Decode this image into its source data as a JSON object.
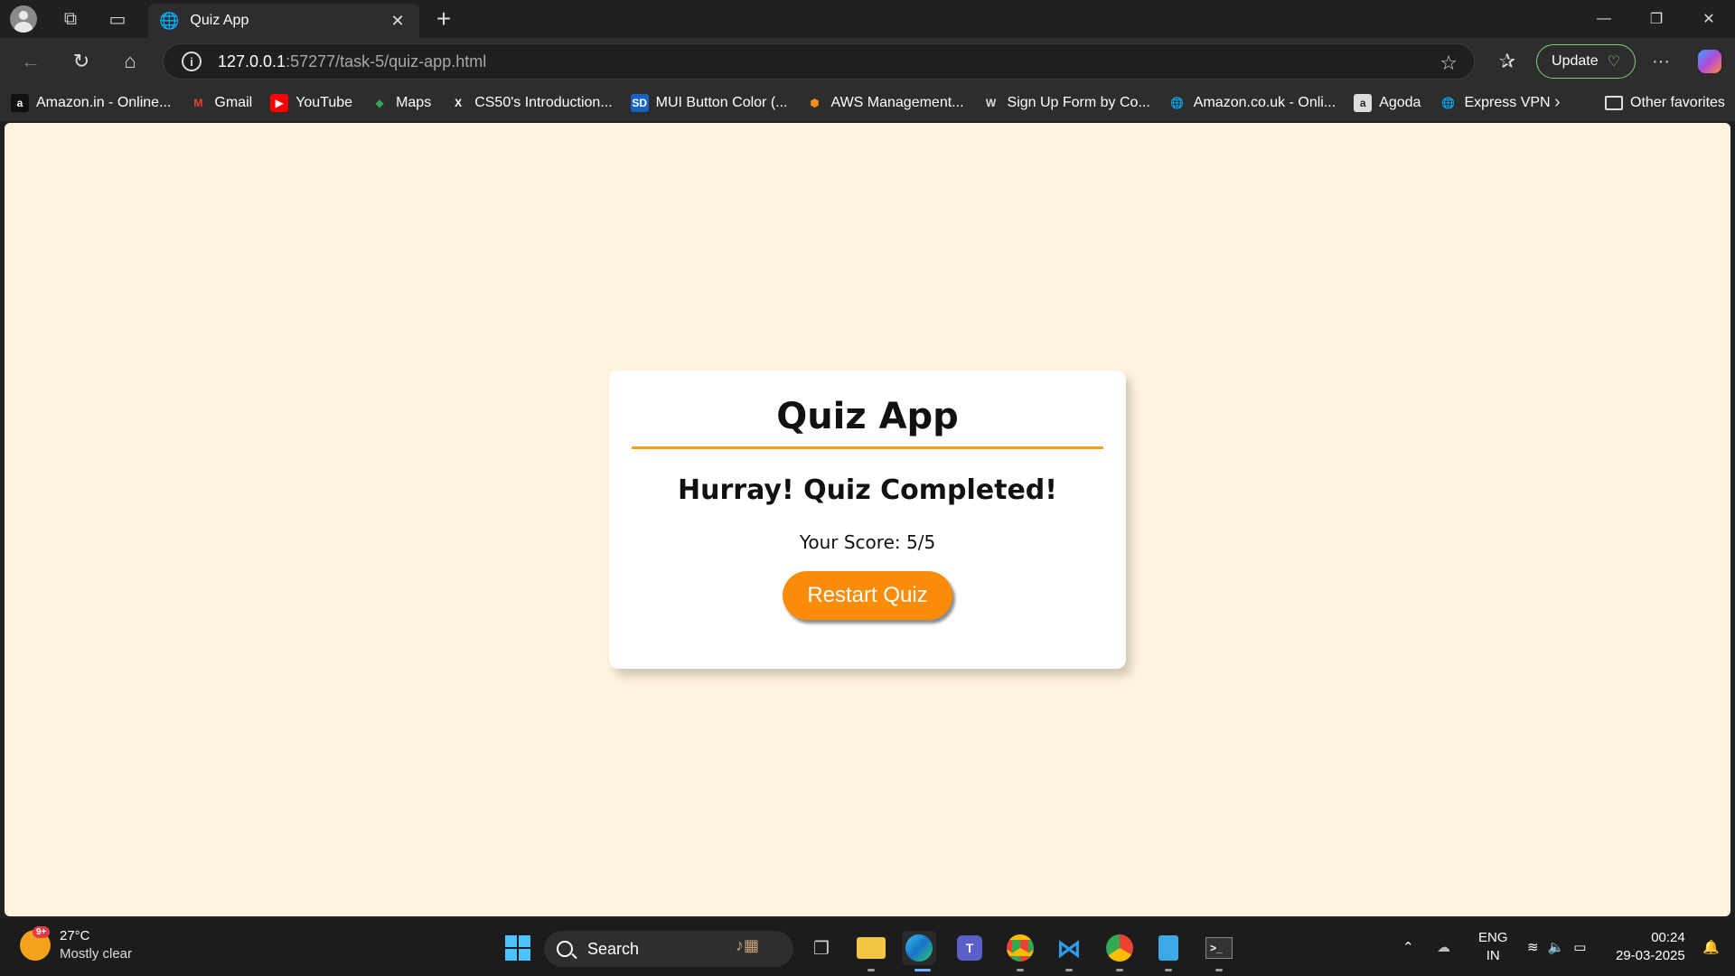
{
  "browser": {
    "tab_title": "Quiz App",
    "url_host": "127.0.0.1",
    "url_rest": ":57277/task-5/quiz-app.html",
    "update_label": "Update"
  },
  "favorites": [
    {
      "label": "Amazon.in - Online...",
      "icon": "a",
      "color": "#ffffff",
      "bg": "#111111"
    },
    {
      "label": "Gmail",
      "icon": "M",
      "color": "#ea4335",
      "bg": "transparent"
    },
    {
      "label": "YouTube",
      "icon": "▶",
      "color": "#ffffff",
      "bg": "#ff0000"
    },
    {
      "label": "Maps",
      "icon": "◆",
      "color": "#34a853",
      "bg": "transparent"
    },
    {
      "label": "CS50's Introduction...",
      "icon": "X",
      "color": "#ffffff",
      "bg": "transparent"
    },
    {
      "label": "MUI Button Color (...",
      "icon": "SD",
      "color": "#ffffff",
      "bg": "#1565c0"
    },
    {
      "label": "AWS Management...",
      "icon": "⬢",
      "color": "#f08c1a",
      "bg": "transparent"
    },
    {
      "label": "Sign Up Form by Co...",
      "icon": "W",
      "color": "#dddddd",
      "bg": "transparent"
    },
    {
      "label": "Amazon.co.uk - Onli...",
      "icon": "🌐",
      "color": "#dddddd",
      "bg": "transparent"
    },
    {
      "label": "Agoda",
      "icon": "a",
      "color": "#222222",
      "bg": "#dddddd"
    },
    {
      "label": "Express VPN",
      "icon": "🌐",
      "color": "#dddddd",
      "bg": "transparent"
    }
  ],
  "favorites_other": "Other favorites",
  "quiz": {
    "title": "Quiz App",
    "heading": "Hurray! Quiz Completed!",
    "score_text": "Your Score: 5/5",
    "restart_label": "Restart Quiz"
  },
  "taskbar": {
    "weather_badge": "9+",
    "temperature": "27°C",
    "condition": "Mostly clear",
    "search_label": "Search",
    "lang_top": "ENG",
    "lang_bottom": "IN",
    "time": "00:24",
    "date": "29-03-2025"
  },
  "colors": {
    "page_bg": "#fff2de",
    "accent": "#fb8c0a",
    "rule": "#f7a21b"
  }
}
